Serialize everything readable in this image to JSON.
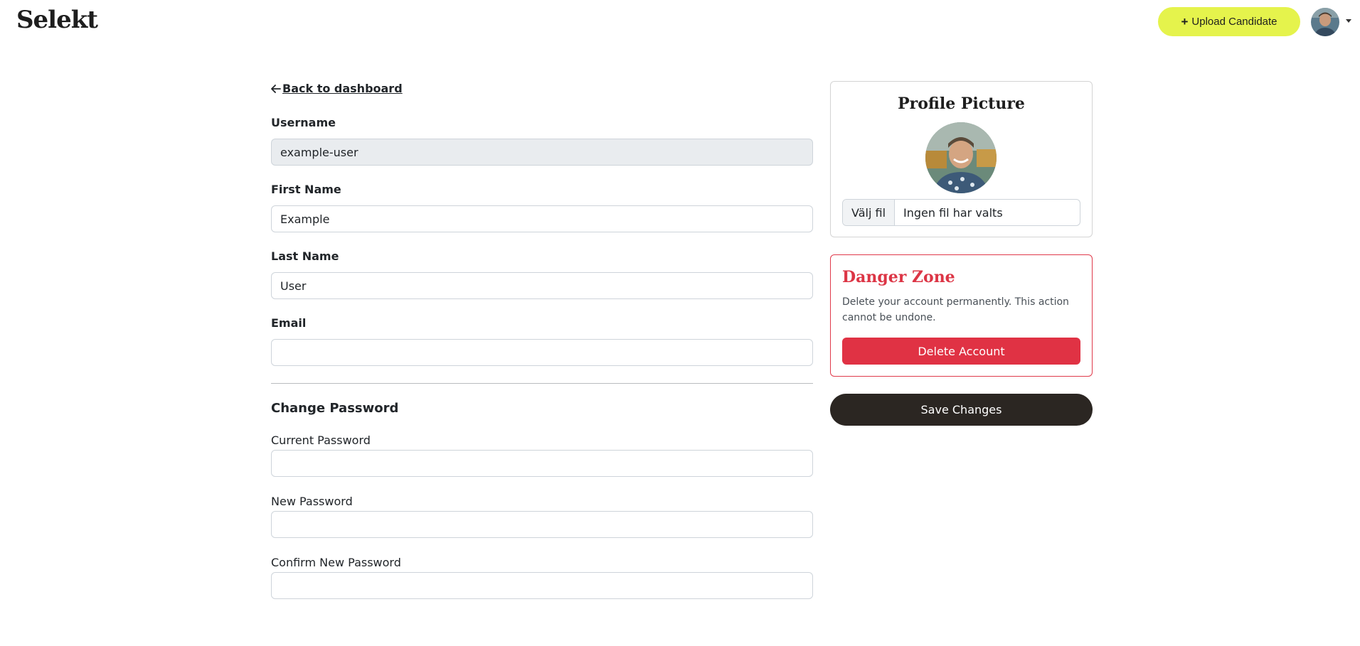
{
  "header": {
    "brand": "Selekt",
    "upload_label": "Upload Candidate",
    "upload_icon": "plus-icon",
    "avatar_icon": "user-avatar",
    "caret_icon": "caret-down-icon"
  },
  "form": {
    "back_link": "Back to dashboard",
    "username": {
      "label": "Username",
      "value": "example-user"
    },
    "first_name": {
      "label": "First Name",
      "value": "Example"
    },
    "last_name": {
      "label": "Last Name",
      "value": "User"
    },
    "email": {
      "label": "Email",
      "value": ""
    },
    "password_section": {
      "title": "Change Password",
      "current": {
        "label": "Current Password",
        "value": ""
      },
      "new": {
        "label": "New Password",
        "value": ""
      },
      "confirm": {
        "label": "Confirm New Password",
        "value": ""
      }
    }
  },
  "profile": {
    "title": "Profile Picture",
    "file_button": "Välj fil",
    "file_status": "Ingen fil har valts"
  },
  "danger": {
    "title": "Danger Zone",
    "text": "Delete your account permanently. This action cannot be undone.",
    "delete_label": "Delete Account"
  },
  "actions": {
    "save_label": "Save Changes"
  },
  "colors": {
    "accent": "#e5f34c",
    "danger": "#dc3545",
    "dark": "#2b2622"
  }
}
